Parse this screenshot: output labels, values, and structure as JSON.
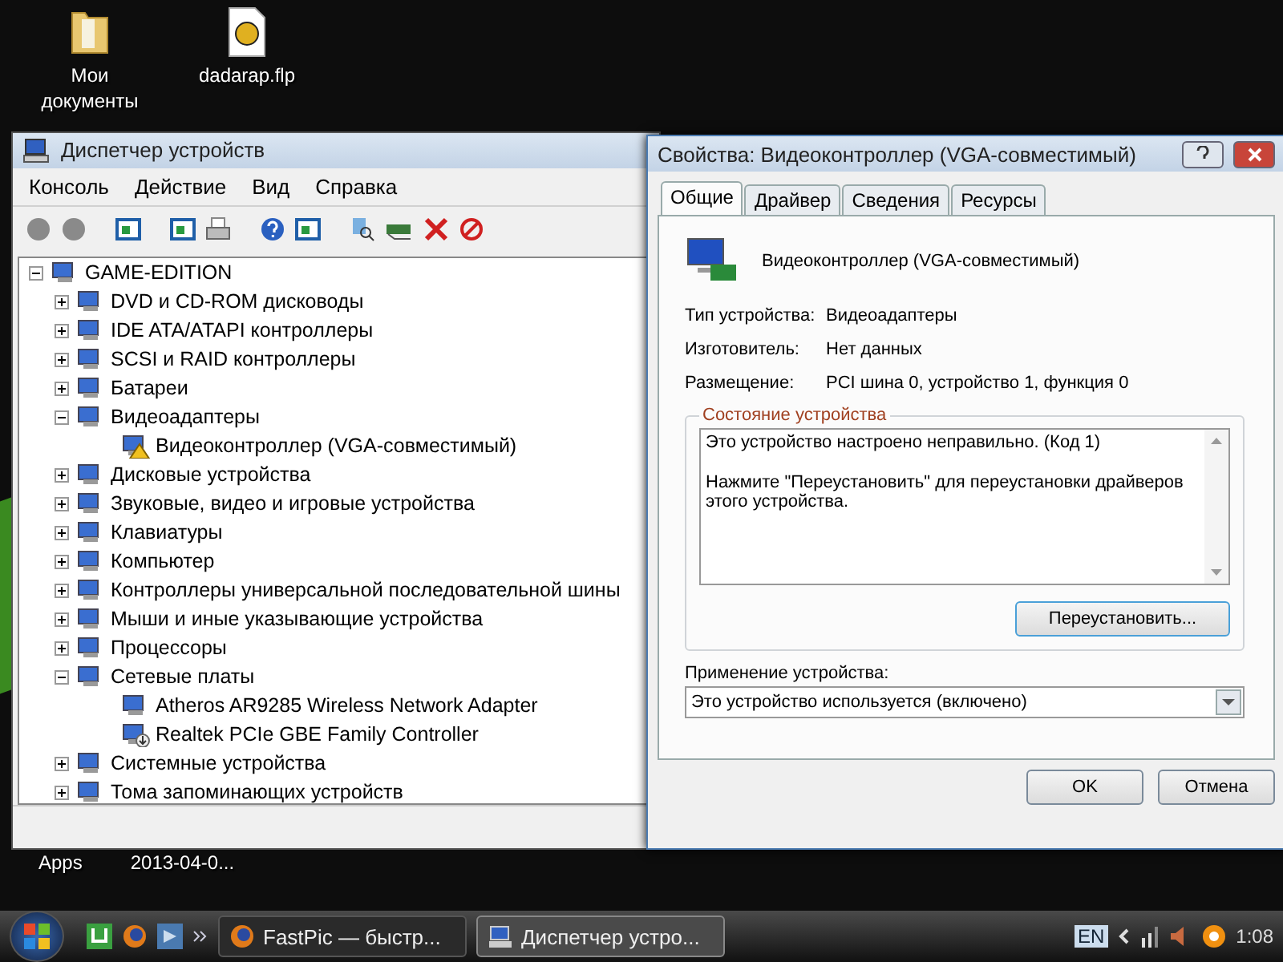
{
  "desktop": {
    "icons": [
      {
        "label": "Мои документы",
        "kind": "folder"
      },
      {
        "label": "dadarap.flp",
        "kind": "file"
      }
    ],
    "partial_icons": [
      {
        "label": "Apps"
      },
      {
        "label": "2013-04-0..."
      }
    ]
  },
  "device_manager": {
    "title": "Диспетчер устройств",
    "menu": [
      "Консоль",
      "Действие",
      "Вид",
      "Справка"
    ],
    "tree": {
      "label": "GAME-EDITION",
      "expanded": true,
      "children": [
        {
          "label": "DVD и CD-ROM дисководы",
          "expanded": false
        },
        {
          "label": "IDE ATA/ATAPI контроллеры",
          "expanded": false
        },
        {
          "label": "SCSI и RAID контроллеры",
          "expanded": false
        },
        {
          "label": "Батареи",
          "expanded": false
        },
        {
          "label": "Видеоадаптеры",
          "expanded": true,
          "children": [
            {
              "label": "Видеоконтроллер (VGA-совместимый)",
              "problem": true,
              "disabled": false
            }
          ]
        },
        {
          "label": "Дисковые устройства",
          "expanded": false
        },
        {
          "label": "Звуковые, видео и игровые устройства",
          "expanded": false
        },
        {
          "label": "Клавиатуры",
          "expanded": false
        },
        {
          "label": "Компьютер",
          "expanded": false
        },
        {
          "label": "Контроллеры универсальной последовательной шины",
          "expanded": false
        },
        {
          "label": "Мыши и иные указывающие устройства",
          "expanded": false
        },
        {
          "label": "Процессоры",
          "expanded": false
        },
        {
          "label": "Сетевые платы",
          "expanded": true,
          "children": [
            {
              "label": "Atheros AR9285 Wireless Network Adapter",
              "problem": false,
              "disabled": false
            },
            {
              "label": "Realtek PCIe GBE Family Controller",
              "problem": false,
              "disabled": true
            }
          ]
        },
        {
          "label": "Системные устройства",
          "expanded": false
        },
        {
          "label": "Тома запоминающих устройств",
          "expanded": false
        }
      ]
    }
  },
  "properties_dialog": {
    "title": "Свойства: Видеоконтроллер (VGA-совместимый)",
    "tabs": [
      {
        "label": "Общие",
        "selected": true
      },
      {
        "label": "Драйвер",
        "selected": false
      },
      {
        "label": "Сведения",
        "selected": false
      },
      {
        "label": "Ресурсы",
        "selected": false
      }
    ],
    "device_name": "Видеоконтроллер (VGA-совместимый)",
    "fields": [
      {
        "label": "Тип устройства:",
        "value": "Видеоадаптеры"
      },
      {
        "label": "Изготовитель:",
        "value": "Нет данных"
      },
      {
        "label": "Размещение:",
        "value": "PCI шина 0, устройство 1, функция 0"
      }
    ],
    "status_group": {
      "title": "Состояние устройства",
      "lines": [
        "Это устройство настроено неправильно. (Код 1)",
        "Нажмите \"Переустановить\" для переустановки драйверов этого устройства."
      ],
      "button": "Переустановить..."
    },
    "usage": {
      "label": "Применение устройства:",
      "value": "Это устройство используется (включено)"
    },
    "buttons": [
      "OK",
      "Отмена"
    ]
  },
  "taskbar": {
    "tasks": [
      {
        "label": "FastPic — быстр...",
        "selected": false
      },
      {
        "label": "Диспетчер устро...",
        "selected": true
      }
    ],
    "language": "EN",
    "clock": "1:08"
  }
}
